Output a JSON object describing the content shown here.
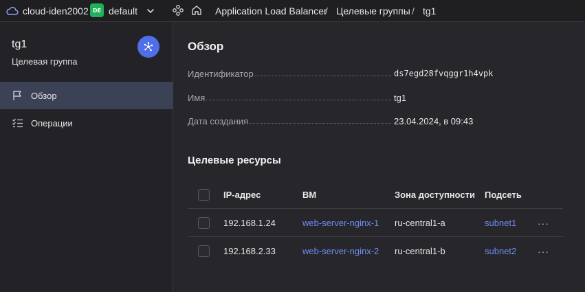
{
  "topbar": {
    "cloud_name": "cloud-iden2002",
    "folder_badge": "DE",
    "folder_name": "default",
    "breadcrumbs": [
      "Application Load Balancer",
      "Целевые группы",
      "tg1"
    ],
    "separator": "/"
  },
  "sidebar": {
    "title": "tg1",
    "subtitle": "Целевая группа",
    "items": [
      {
        "label": "Обзор",
        "icon": "flag-icon",
        "active": true
      },
      {
        "label": "Операции",
        "icon": "checklist-icon",
        "active": false
      }
    ]
  },
  "overview": {
    "heading": "Обзор",
    "fields": [
      {
        "key": "Идентификатор",
        "value": "ds7egd28fvqggr1h4vpk"
      },
      {
        "key": "Имя",
        "value": "tg1"
      },
      {
        "key": "Дата создания",
        "value": "23.04.2024, в 09:43"
      }
    ]
  },
  "resources": {
    "heading": "Целевые ресурсы",
    "columns": [
      "IP-адрес",
      "ВМ",
      "Зона доступности",
      "Подсеть"
    ],
    "rows": [
      {
        "ip": "192.168.1.24",
        "vm": "web-server-nginx-1",
        "zone": "ru-central1-a",
        "subnet": "subnet1"
      },
      {
        "ip": "192.168.2.33",
        "vm": "web-server-nginx-2",
        "zone": "ru-central1-b",
        "subnet": "subnet2"
      }
    ],
    "more_glyph": "···"
  },
  "colors": {
    "accent": "#4f6ee8",
    "link": "#6f8cf5",
    "folder_badge": "#1fb25a",
    "active_nav": "#3c4256"
  }
}
